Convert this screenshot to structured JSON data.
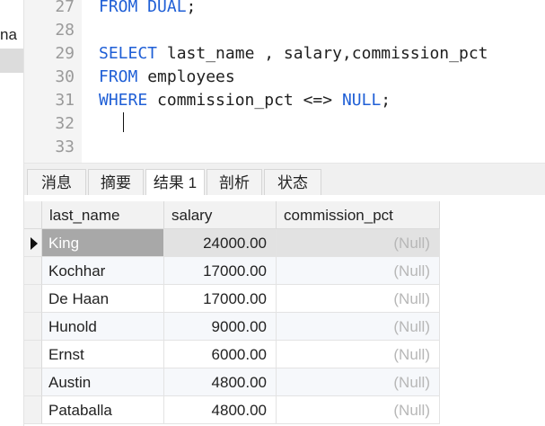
{
  "sidebar": {
    "fragment_text": "na"
  },
  "editor": {
    "lines": [
      {
        "num": "27",
        "parts": [
          {
            "t": "FROM DUAL",
            "k": true
          },
          {
            "t": ";",
            "k": false
          }
        ]
      },
      {
        "num": "28",
        "parts": []
      },
      {
        "num": "29",
        "parts": [
          {
            "t": "SELECT",
            "k": true
          },
          {
            "t": " last_name , salary,commission_pct",
            "k": false
          }
        ]
      },
      {
        "num": "30",
        "parts": [
          {
            "t": "FROM",
            "k": true
          },
          {
            "t": " employees",
            "k": false
          }
        ]
      },
      {
        "num": "31",
        "parts": [
          {
            "t": "WHERE",
            "k": true
          },
          {
            "t": " commission_pct <=> ",
            "k": false
          },
          {
            "t": "NULL",
            "k": true
          },
          {
            "t": ";",
            "k": false
          }
        ]
      },
      {
        "num": "32",
        "parts": []
      },
      {
        "num": "33",
        "parts": []
      }
    ]
  },
  "tabs": [
    {
      "label": "消息",
      "active": false
    },
    {
      "label": "摘要",
      "active": false
    },
    {
      "label": "结果 1",
      "active": true
    },
    {
      "label": "剖析",
      "active": false
    },
    {
      "label": "状态",
      "active": false
    }
  ],
  "grid": {
    "columns": [
      "last_name",
      "salary",
      "commission_pct"
    ],
    "rows": [
      {
        "last_name": "King",
        "salary": "24000.00",
        "commission_pct": "(Null)",
        "selected": true
      },
      {
        "last_name": "Kochhar",
        "salary": "17000.00",
        "commission_pct": "(Null)"
      },
      {
        "last_name": "De Haan",
        "salary": "17000.00",
        "commission_pct": "(Null)"
      },
      {
        "last_name": "Hunold",
        "salary": "9000.00",
        "commission_pct": "(Null)"
      },
      {
        "last_name": "Ernst",
        "salary": "6000.00",
        "commission_pct": "(Null)"
      },
      {
        "last_name": "Austin",
        "salary": "4800.00",
        "commission_pct": "(Null)"
      },
      {
        "last_name": "Pataballa",
        "salary": "4800.00",
        "commission_pct": "(Null)"
      }
    ]
  },
  "colors": {
    "keyword": "#1f5fd6",
    "null_text": "#b7b7b7",
    "selected_name_bg": "#a8a8a8"
  }
}
